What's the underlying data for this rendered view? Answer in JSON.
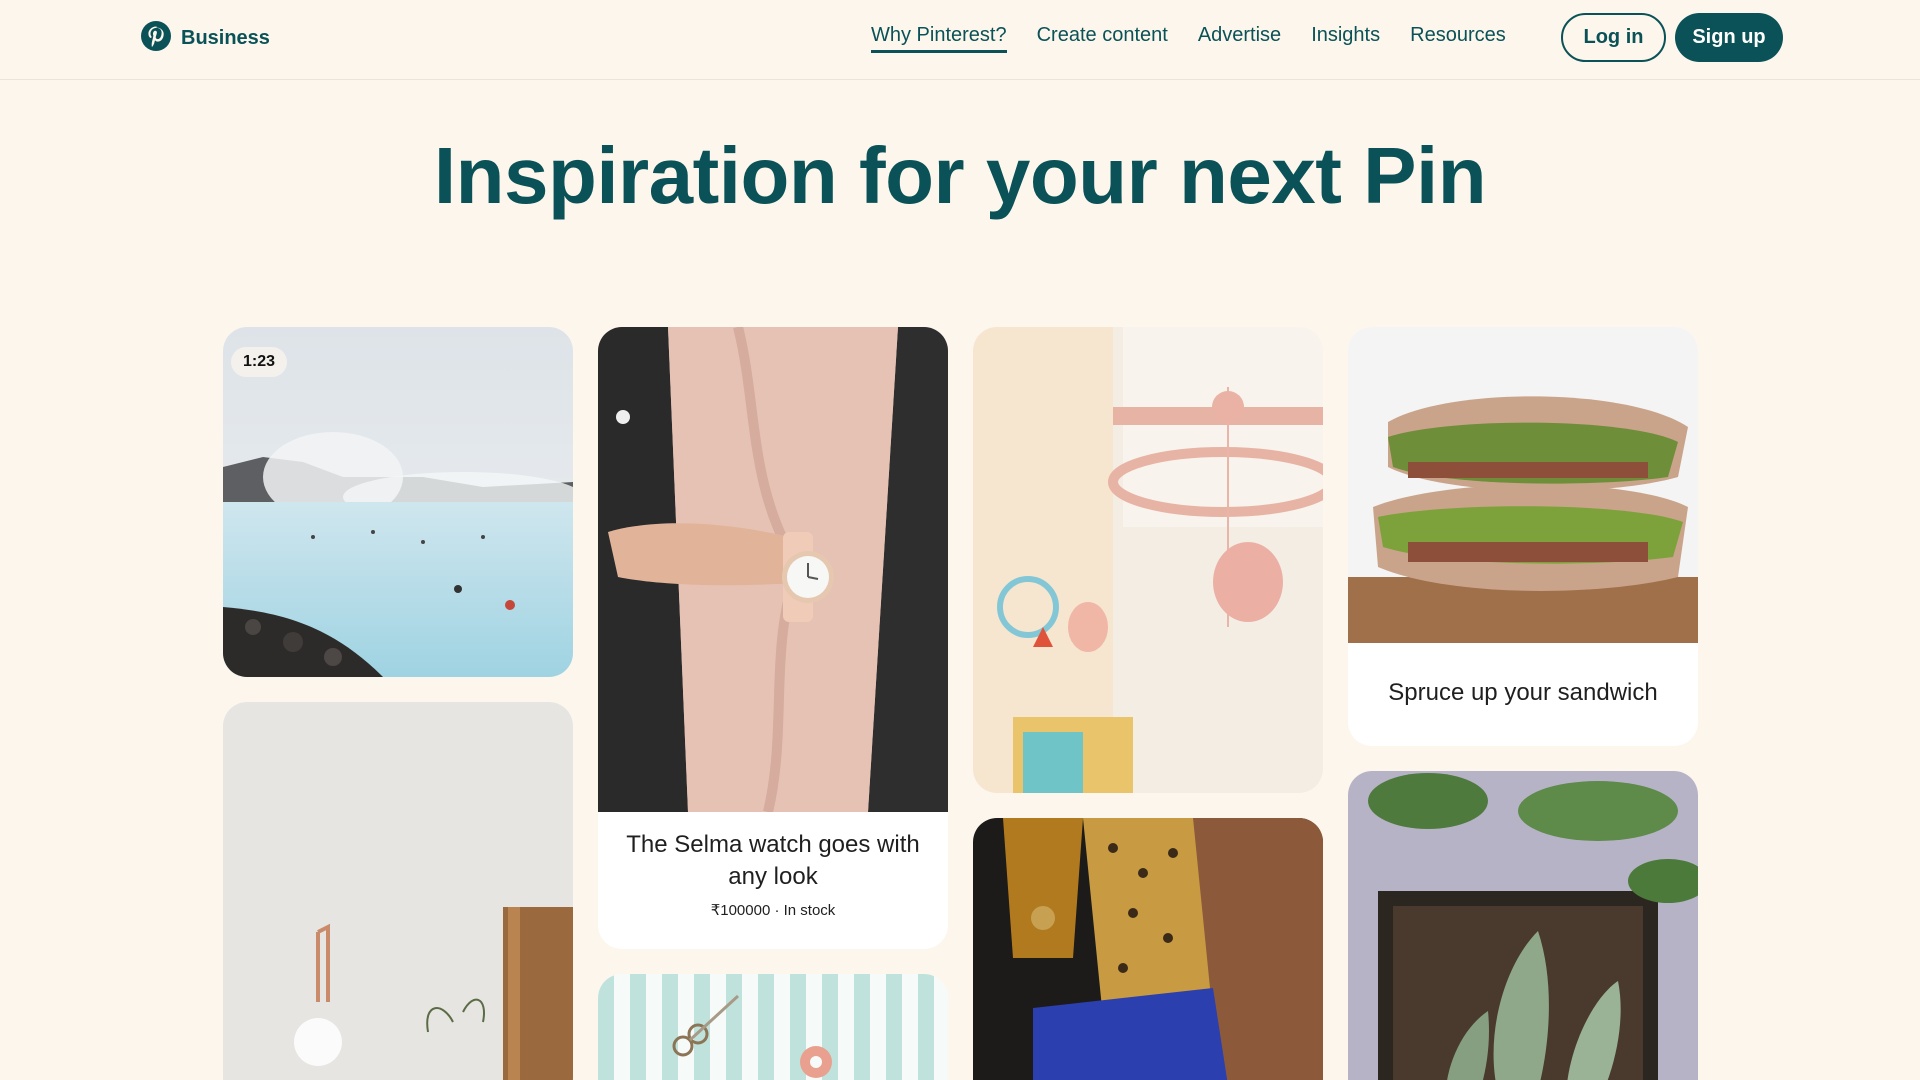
{
  "header": {
    "brand": "Business",
    "logo_icon": "pinterest-logo-icon",
    "nav": [
      {
        "label": "Why Pinterest?",
        "active": true
      },
      {
        "label": "Create content",
        "active": false
      },
      {
        "label": "Advertise",
        "active": false
      },
      {
        "label": "Insights",
        "active": false
      },
      {
        "label": "Resources",
        "active": false
      }
    ],
    "login_label": "Log in",
    "signup_label": "Sign up"
  },
  "hero": {
    "title": "Inspiration for your next Pin"
  },
  "pins": {
    "lagoon": {
      "badge": "1:23"
    },
    "watch": {
      "title": "The Selma watch goes with any look",
      "meta": "₹100000 · In stock"
    },
    "sandwich": {
      "title": "Spruce up your sandwich"
    }
  },
  "colors": {
    "accent": "#0a5257",
    "background": "#fdf6ec"
  }
}
